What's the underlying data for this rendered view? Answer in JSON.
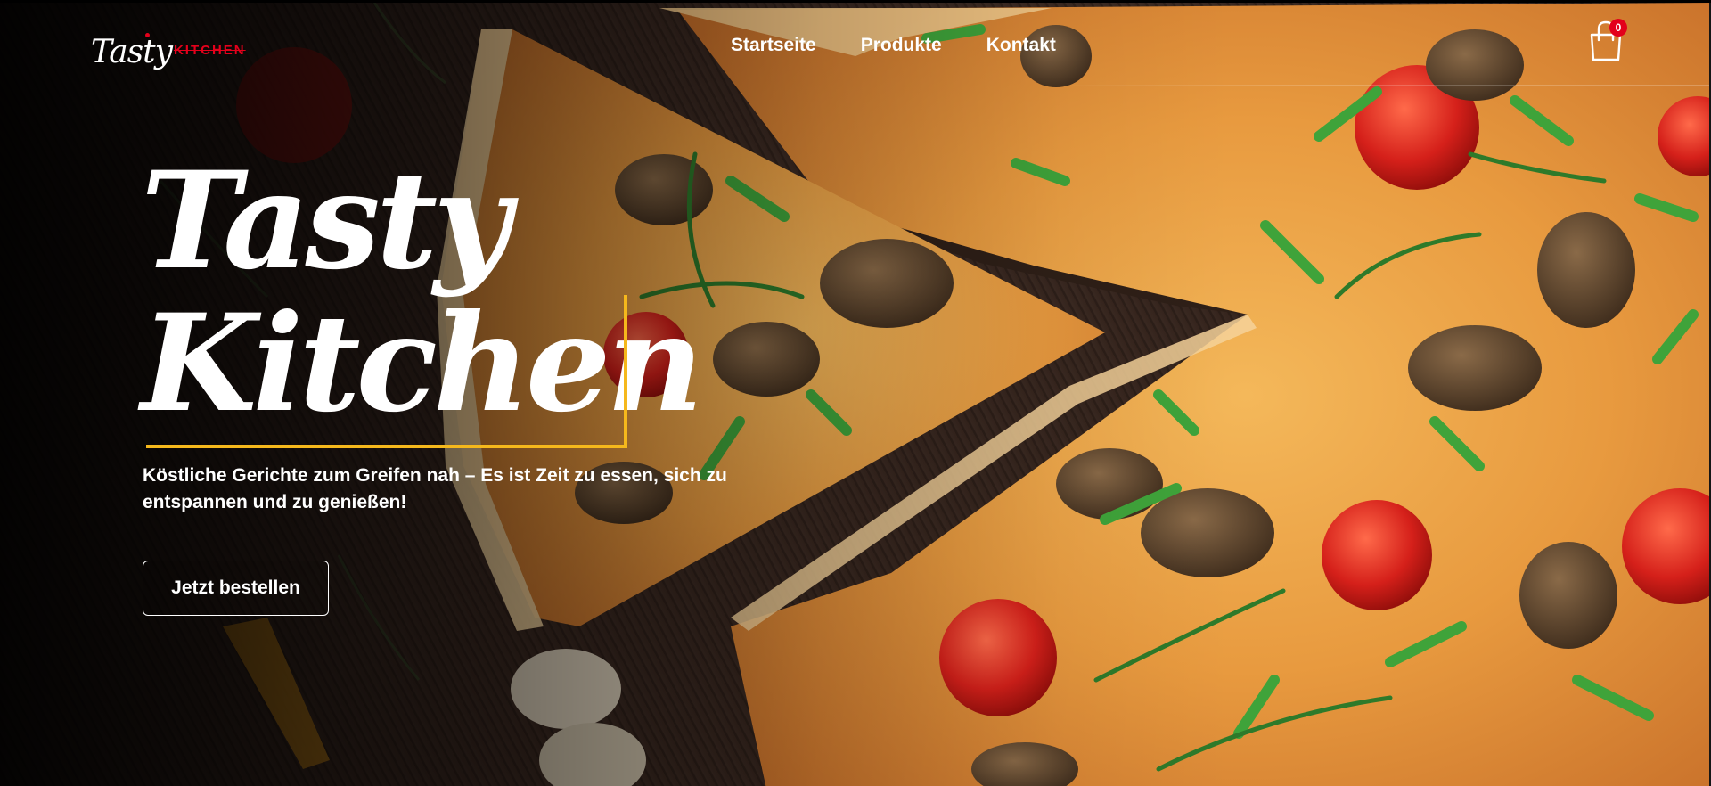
{
  "header": {
    "logo": {
      "script": "Tasty",
      "word": "KITCHEN"
    },
    "nav": [
      {
        "label": "Startseite"
      },
      {
        "label": "Produkte"
      },
      {
        "label": "Kontakt"
      }
    ],
    "cart": {
      "count": "0"
    }
  },
  "hero": {
    "title_line1": "Tasty",
    "title_line2": "Kitchen",
    "subtitle": "Köstliche Gerichte zum Greifen nah – Es ist Zeit zu essen, sich zu entspannen und zu genießen!",
    "cta_label": "Jetzt bestellen"
  },
  "colors": {
    "accent": "#f5b81c",
    "brand_red": "#e3001b",
    "text": "#ffffff",
    "background": "#2a1c17"
  },
  "icons": {
    "cart": "shopping-bag-icon"
  }
}
